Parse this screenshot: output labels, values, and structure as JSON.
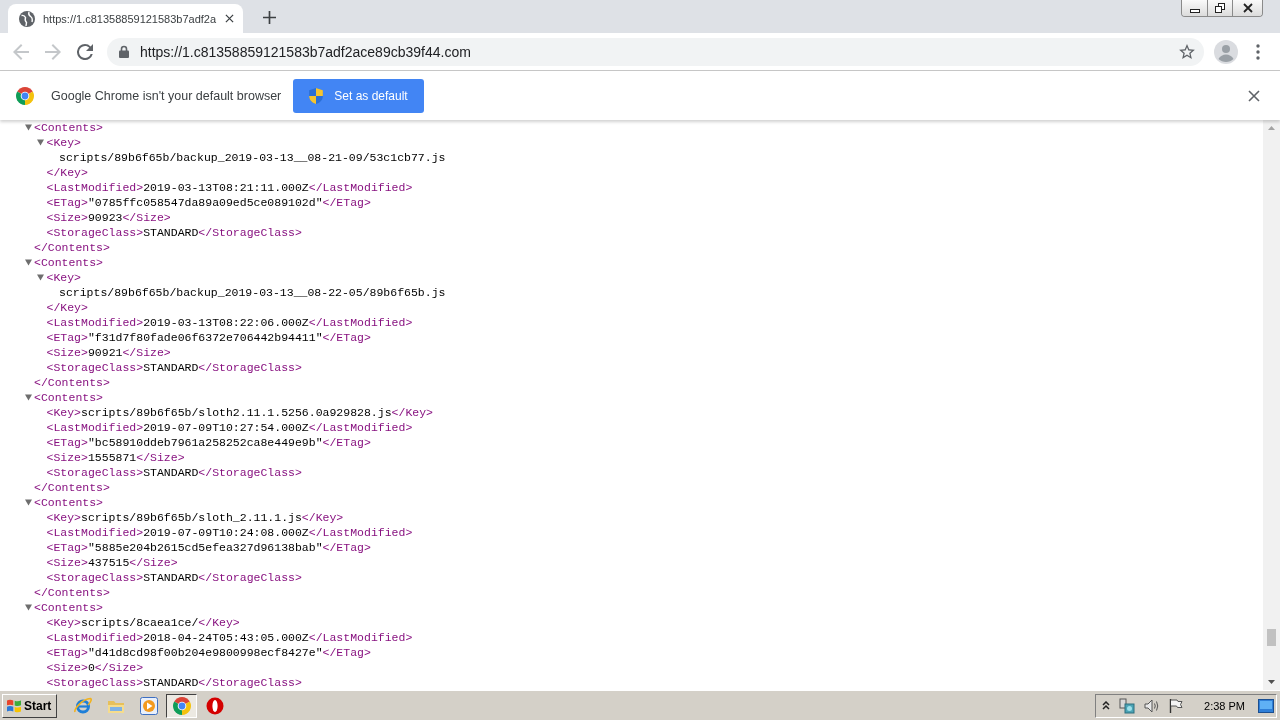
{
  "tab": {
    "title": "https://1.c81358859121583b7adf2a"
  },
  "toolbar": {
    "buttons": [
      {
        "kind": "back",
        "disabled": true
      },
      {
        "kind": "forward",
        "disabled": true
      },
      {
        "kind": "reload",
        "disabled": false
      }
    ],
    "url": "https://1.c81358859121583b7adf2ace89cb39f44.com"
  },
  "infobar": {
    "message": "Google Chrome isn't your default browser",
    "button": "Set as default"
  },
  "xml": [
    {
      "open": "<Contents>",
      "expanded": true,
      "children": [
        {
          "open": "<Key>",
          "expanded": true,
          "children": [
            {
              "text": "scripts/89b6f65b/backup_2019-03-13__08-21-09/53c1cb77.js"
            }
          ],
          "close": "</Key>"
        },
        {
          "open": "<LastModified>",
          "text": "2019-03-13T08:21:11.000Z",
          "close": "</LastModified>"
        },
        {
          "open": "<ETag>",
          "text": "\"0785ffc058547da89a09ed5ce089102d\"",
          "close": "</ETag>"
        },
        {
          "open": "<Size>",
          "text": "90923",
          "close": "</Size>"
        },
        {
          "open": "<StorageClass>",
          "text": "STANDARD",
          "close": "</StorageClass>"
        }
      ],
      "close": "</Contents>"
    },
    {
      "open": "<Contents>",
      "expanded": true,
      "children": [
        {
          "open": "<Key>",
          "expanded": true,
          "children": [
            {
              "text": "scripts/89b6f65b/backup_2019-03-13__08-22-05/89b6f65b.js"
            }
          ],
          "close": "</Key>"
        },
        {
          "open": "<LastModified>",
          "text": "2019-03-13T08:22:06.000Z",
          "close": "</LastModified>"
        },
        {
          "open": "<ETag>",
          "text": "\"f31d7f80fade06f6372e706442b94411\"",
          "close": "</ETag>"
        },
        {
          "open": "<Size>",
          "text": "90921",
          "close": "</Size>"
        },
        {
          "open": "<StorageClass>",
          "text": "STANDARD",
          "close": "</StorageClass>"
        }
      ],
      "close": "</Contents>"
    },
    {
      "open": "<Contents>",
      "expanded": true,
      "children": [
        {
          "open": "<Key>",
          "text": "scripts/89b6f65b/sloth2.11.1.5256.0a929828.js",
          "close": "</Key>"
        },
        {
          "open": "<LastModified>",
          "text": "2019-07-09T10:27:54.000Z",
          "close": "</LastModified>"
        },
        {
          "open": "<ETag>",
          "text": "\"bc58910ddeb7961a258252ca8e449e9b\"",
          "close": "</ETag>"
        },
        {
          "open": "<Size>",
          "text": "1555871",
          "close": "</Size>"
        },
        {
          "open": "<StorageClass>",
          "text": "STANDARD",
          "close": "</StorageClass>"
        }
      ],
      "close": "</Contents>"
    },
    {
      "open": "<Contents>",
      "expanded": true,
      "children": [
        {
          "open": "<Key>",
          "text": "scripts/89b6f65b/sloth_2.11.1.js",
          "close": "</Key>"
        },
        {
          "open": "<LastModified>",
          "text": "2019-07-09T10:24:08.000Z",
          "close": "</LastModified>"
        },
        {
          "open": "<ETag>",
          "text": "\"5885e204b2615cd5efea327d96138bab\"",
          "close": "</ETag>"
        },
        {
          "open": "<Size>",
          "text": "437515",
          "close": "</Size>"
        },
        {
          "open": "<StorageClass>",
          "text": "STANDARD",
          "close": "</StorageClass>"
        }
      ],
      "close": "</Contents>"
    },
    {
      "open": "<Contents>",
      "expanded": true,
      "children": [
        {
          "open": "<Key>",
          "text": "scripts/8caea1ce/",
          "close": "</Key>"
        },
        {
          "open": "<LastModified>",
          "text": "2018-04-24T05:43:05.000Z",
          "close": "</LastModified>"
        },
        {
          "open": "<ETag>",
          "text": "\"d41d8cd98f00b204e9800998ecf8427e\"",
          "close": "</ETag>"
        },
        {
          "open": "<Size>",
          "text": "0",
          "close": "</Size>"
        },
        {
          "open": "<StorageClass>",
          "text": "STANDARD",
          "close": "</StorageClass>"
        }
      ]
    }
  ],
  "taskbar": {
    "start": "Start",
    "apps": [
      {
        "kind": "browser",
        "selected": false
      },
      {
        "kind": "folder",
        "selected": false
      },
      {
        "kind": "player",
        "selected": false
      },
      {
        "kind": "chrome",
        "selected": true
      },
      {
        "kind": "opera",
        "selected": false
      }
    ],
    "clock": "2:38 PM"
  }
}
